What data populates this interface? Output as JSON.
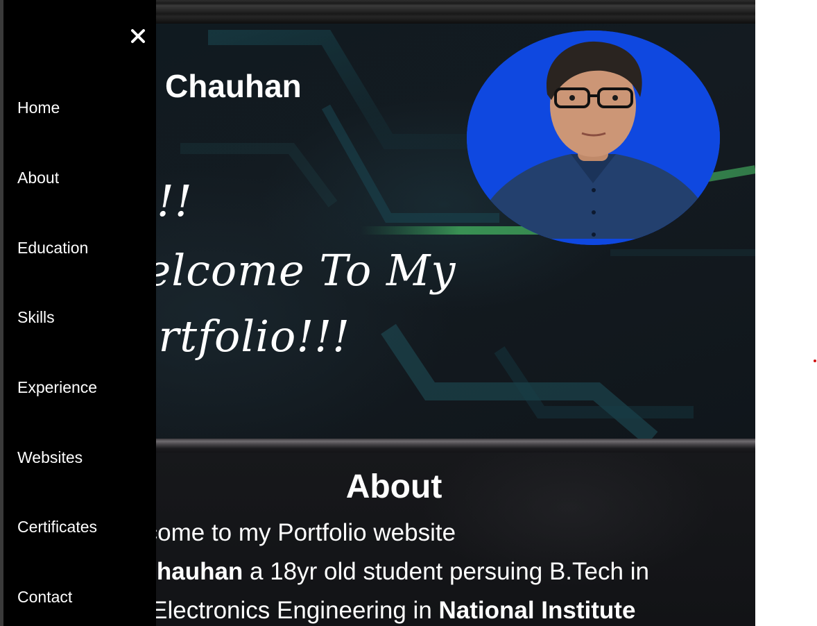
{
  "header": {
    "name_fragment": "Chauhan"
  },
  "greeting": {
    "line1": "Hi!!",
    "line2": "Welcome To My",
    "line3": "Portfolio!!!"
  },
  "about": {
    "heading": "About",
    "line1": "Welcome to my Portfolio website",
    "line2_bold": "na Chauhan",
    "line2_rest": " a 18yr old student persuing B.Tech in",
    "line3_start": "and Electronics Engineering in ",
    "line3_bold": "National Institute"
  },
  "sidenav": {
    "close_icon": "close-icon",
    "items": [
      {
        "label": "Home"
      },
      {
        "label": "About"
      },
      {
        "label": "Education"
      },
      {
        "label": "Skills"
      },
      {
        "label": "Experience"
      },
      {
        "label": "Websites"
      },
      {
        "label": "Certificates"
      },
      {
        "label": "Contact"
      }
    ]
  },
  "colors": {
    "sidenav_bg": "#000000",
    "avatar_bg": "#0f48e0",
    "accent_green": "#3fa35a",
    "text": "#ffffff"
  }
}
